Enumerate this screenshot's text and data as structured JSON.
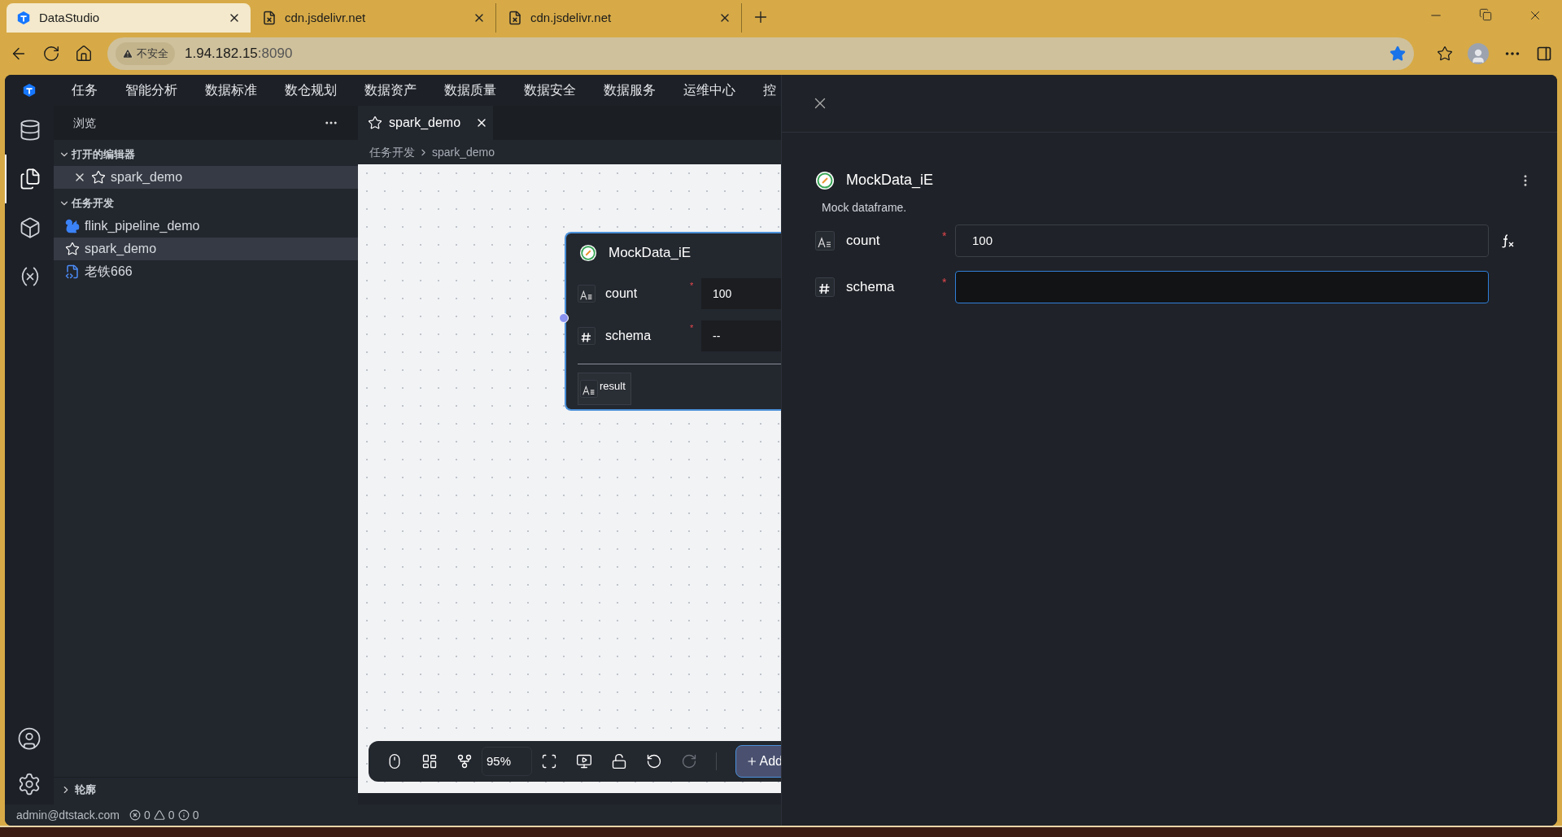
{
  "browser": {
    "tabs": [
      {
        "title": "DataStudio",
        "selected": true,
        "kind": "app"
      },
      {
        "title": "cdn.jsdelivr.net",
        "selected": false,
        "kind": "file"
      },
      {
        "title": "cdn.jsdelivr.net",
        "selected": false,
        "kind": "file"
      }
    ],
    "address": {
      "security": "不安全",
      "host": "1.94.182.15",
      "port": ":8090",
      "bookmarked": true
    }
  },
  "menu": [
    "任务",
    "智能分析",
    "数据标准",
    "数仓规划",
    "数据资产",
    "数据质量",
    "数据安全",
    "数据服务",
    "运维中心",
    "控"
  ],
  "activity_bar": [
    {
      "kind": "database",
      "selected": false
    },
    {
      "kind": "files",
      "selected": true
    },
    {
      "kind": "box",
      "selected": false
    },
    {
      "kind": "variable",
      "selected": false
    }
  ],
  "sidebar": {
    "title": "浏览",
    "sections": [
      {
        "title": "打开的编辑器",
        "expanded": true,
        "items": [
          {
            "label": "spark_demo",
            "kind": "spark",
            "selected": true,
            "closable": true
          }
        ]
      },
      {
        "title": "任务开发",
        "expanded": true,
        "items": [
          {
            "label": "flink_pipeline_demo",
            "kind": "flink",
            "selected": false,
            "closable": false
          },
          {
            "label": "spark_demo",
            "kind": "spark",
            "selected": true,
            "closable": false
          },
          {
            "label": "老铁666",
            "kind": "script",
            "selected": false,
            "closable": false
          }
        ]
      }
    ],
    "outline": {
      "title": "轮廓",
      "expanded": false
    }
  },
  "editor": {
    "tabs": [
      {
        "label": "spark_demo",
        "selected": true
      }
    ],
    "breadcrumb": [
      "任务开发",
      "spark_demo"
    ],
    "node": {
      "title": "MockData_iE",
      "params": [
        {
          "name": "count",
          "kind": "text",
          "required": "*",
          "value": "100"
        },
        {
          "name": "schema",
          "kind": "number",
          "required": "*",
          "value": "--"
        }
      ],
      "output": "result"
    },
    "toolbar": {
      "tools": [
        {
          "kind": "mouse",
          "disabled": false
        },
        {
          "kind": "layout",
          "disabled": false
        },
        {
          "kind": "branch",
          "disabled": false
        },
        {
          "kind": "zoom"
        },
        {
          "kind": "fit",
          "disabled": false
        },
        {
          "kind": "preview",
          "disabled": false
        },
        {
          "kind": "lock",
          "disabled": false
        },
        {
          "kind": "undo",
          "disabled": false
        },
        {
          "kind": "redo",
          "disabled": true
        }
      ],
      "zoom": "95%",
      "add_button": "Add"
    }
  },
  "drawer": {
    "title": "MockData_iE",
    "description": "Mock dataframe.",
    "params": [
      {
        "name": "count",
        "kind": "text",
        "required": "*",
        "value": "100",
        "focused": false,
        "formula": true
      },
      {
        "name": "schema",
        "kind": "number",
        "required": "*",
        "focused": true,
        "formula": false
      }
    ]
  },
  "status_bar": {
    "user": "admin@dtstack.com",
    "errors": "0",
    "warnings": "0",
    "infos": "0"
  }
}
